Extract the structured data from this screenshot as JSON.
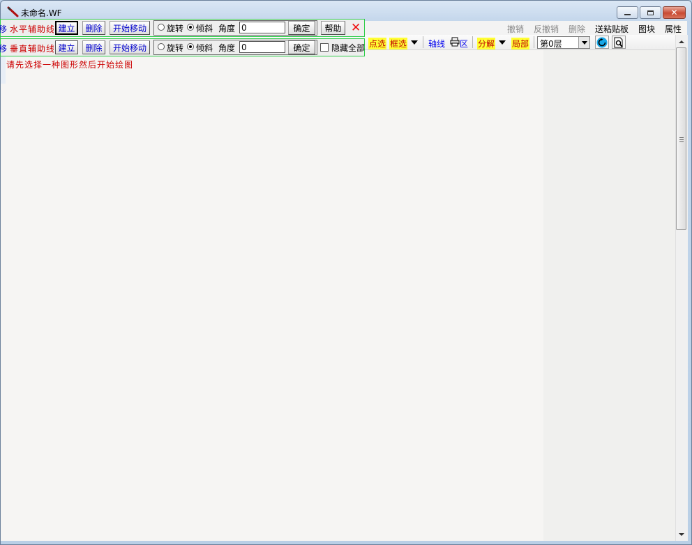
{
  "window": {
    "title": "未命名.WF",
    "icon": "pencil-icon",
    "controls": [
      "minimize-icon",
      "maximize-icon",
      "close-icon"
    ]
  },
  "menu": {
    "undo": "撤销",
    "redo": "反撤销",
    "delete": "删除",
    "send_clipboard": "送粘贴板",
    "block": "图块",
    "properties": "属性"
  },
  "toolbar": {
    "point_select": "点选",
    "box_select": "框选",
    "axis_line": "轴线",
    "print_area_label": "区",
    "explode": "分解",
    "partial": "局部",
    "floor_value": "第0层"
  },
  "horizontal_guide": {
    "move_label": "移",
    "label": "水平辅助线",
    "create": "建立",
    "delete": "删除",
    "start_move": "开始移动",
    "rotate": "旋转",
    "tilt": "倾斜",
    "angle_label": "角度",
    "angle_value": "0",
    "confirm": "确定",
    "help": "帮助"
  },
  "vertical_guide": {
    "move_label": "移",
    "label": "垂直辅助线",
    "create": "建立",
    "delete": "删除",
    "start_move": "开始移动",
    "rotate": "旋转",
    "tilt": "倾斜",
    "angle_label": "角度",
    "angle_value": "0",
    "confirm": "确定",
    "hide_all": "隐藏全部"
  },
  "canvas": {
    "message": "请先选择一种图形然后开始绘图"
  },
  "colors": {
    "guide_border": "#2ecc4a",
    "label_red": "#cc0000",
    "button_blue": "#0000cc",
    "highlight_yellow": "#ffff33"
  }
}
